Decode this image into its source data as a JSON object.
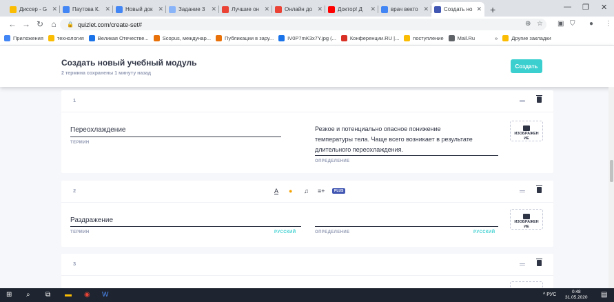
{
  "browser": {
    "tabs": [
      {
        "label": "Диссер - G",
        "color": "#fbbc04",
        "active": false
      },
      {
        "label": "Паутова К.",
        "color": "#4285f4",
        "active": false
      },
      {
        "label": "Новый док",
        "color": "#4285f4",
        "active": false
      },
      {
        "label": "Задание 3",
        "color": "#8ab4f8",
        "active": false
      },
      {
        "label": "Лучшие он",
        "color": "#ea4335",
        "active": false
      },
      {
        "label": "Онлайн до",
        "color": "#ea4335",
        "active": false
      },
      {
        "label": "Доктор! Д",
        "color": "#ff0000",
        "active": false
      },
      {
        "label": "врач векто",
        "color": "#4285f4",
        "active": false
      },
      {
        "label": "Создать но",
        "color": "#4257b2",
        "active": true
      }
    ],
    "new_tab": "+",
    "url": "quizlet.com/create-set#",
    "bookmarks": [
      {
        "label": "Приложения",
        "color": "#4285f4"
      },
      {
        "label": "технология",
        "color": "#fbbc04"
      },
      {
        "label": "Великая Отечестве...",
        "color": "#1a73e8"
      },
      {
        "label": "Scopus, междунар...",
        "color": "#e8710a"
      },
      {
        "label": "Публикации в зару...",
        "color": "#e8710a"
      },
      {
        "label": "IV0P7mK3x7Y.jpg (...",
        "color": "#1a73e8"
      },
      {
        "label": "Конференции.RU |...",
        "color": "#d93025"
      },
      {
        "label": "поступление",
        "color": "#fbbc04"
      },
      {
        "label": "Mail.Ru",
        "color": "#5f6368"
      }
    ],
    "other_bookmarks": "Другие закладки"
  },
  "header": {
    "title": "Создать новый учебный модуль",
    "subtitle": "2 термина сохранены 1 минуту назад",
    "create_button": "Создать"
  },
  "cards": [
    {
      "number": "1",
      "term": "Переохлаждение",
      "term_label": "ТЕРМИН",
      "definition_lines": [
        "Резкое и потенциально опасное понижение",
        "температуры тела. Чаще всего возникает в результате",
        "длительного переохлаждения."
      ],
      "definition_label": "ОПРЕДЕЛЕНИЕ",
      "image_label_1": "ИЗОБРАЖЕН",
      "image_label_2": "ИЕ"
    },
    {
      "number": "2",
      "term": "Раздражение",
      "term_label": "ТЕРМИН",
      "term_lang": "РУССКИЙ",
      "definition_label": "ОПРЕДЕЛЕНИЕ",
      "definition_lang": "РУССКИЙ",
      "image_label_1": "ИЗОБРАЖЕН",
      "image_label_2": "ИЕ",
      "plus_badge": "PLUS"
    },
    {
      "number": "3"
    }
  ],
  "taskbar": {
    "lang": "РУС",
    "time": "0:48",
    "date": "31.05.2020"
  }
}
